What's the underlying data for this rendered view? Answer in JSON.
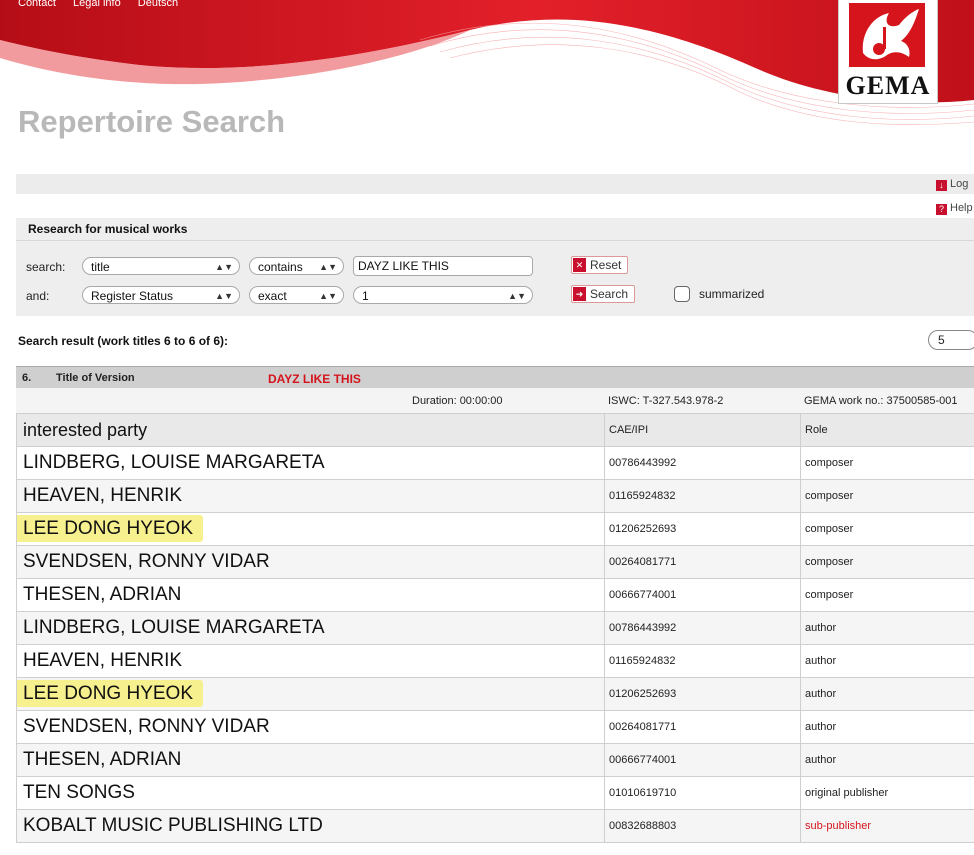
{
  "top_links": [
    "Contact",
    "Legal info",
    "Deutsch"
  ],
  "logo_text": "GEMA",
  "page_title": "Repertoire Search",
  "side_links": [
    {
      "label": "Log",
      "icon": "logout-icon"
    },
    {
      "label": "Help",
      "icon": "help-icon"
    }
  ],
  "search_panel": {
    "title": "Research for musical works",
    "row1": {
      "label": "search:",
      "field": "title",
      "operator": "contains",
      "value": "DAYZ LIKE THIS",
      "button": "Reset"
    },
    "row2": {
      "label": "and:",
      "field": "Register Status",
      "operator": "exact",
      "value": "1",
      "button": "Search",
      "checkbox_label": "summarized"
    }
  },
  "result": {
    "title": "Search result (work titles 6 to 6 of 6):",
    "pager_value": "5",
    "work": {
      "number": "6.",
      "version_label": "Title of Version",
      "title": "DAYZ LIKE THIS",
      "duration": "Duration: 00:00:00",
      "iswc": "ISWC: T-327.543.978-2",
      "gema_no": "GEMA work no.: 37500585-001"
    }
  },
  "parties": {
    "headers": [
      "interested party",
      "CAE/IPI",
      "Role"
    ],
    "rows": [
      {
        "name": "LINDBERG, LOUISE MARGARETA",
        "ipi": "00786443992",
        "role": "composer"
      },
      {
        "name": "HEAVEN, HENRIK",
        "ipi": "01165924832",
        "role": "composer"
      },
      {
        "name": "LEE DONG HYEOK",
        "ipi": "01206252693",
        "role": "composer",
        "highlight": true
      },
      {
        "name": "SVENDSEN, RONNY VIDAR",
        "ipi": "00264081771",
        "role": "composer"
      },
      {
        "name": "THESEN, ADRIAN",
        "ipi": "00666774001",
        "role": "composer"
      },
      {
        "name": "LINDBERG, LOUISE MARGARETA",
        "ipi": "00786443992",
        "role": "author"
      },
      {
        "name": "HEAVEN, HENRIK",
        "ipi": "01165924832",
        "role": "author"
      },
      {
        "name": "LEE DONG HYEOK",
        "ipi": "01206252693",
        "role": "author",
        "highlight": true
      },
      {
        "name": "SVENDSEN, RONNY VIDAR",
        "ipi": "00264081771",
        "role": "author"
      },
      {
        "name": "THESEN, ADRIAN",
        "ipi": "00666774001",
        "role": "author"
      },
      {
        "name": "TEN SONGS",
        "ipi": "01010619710",
        "role": "original publisher"
      },
      {
        "name": "KOBALT MUSIC PUBLISHING LTD",
        "ipi": "00832688803",
        "role": "sub-publisher",
        "role_red": true
      }
    ]
  },
  "colors": {
    "brand_red": "#d4141c",
    "highlight": "#f6f08e"
  }
}
